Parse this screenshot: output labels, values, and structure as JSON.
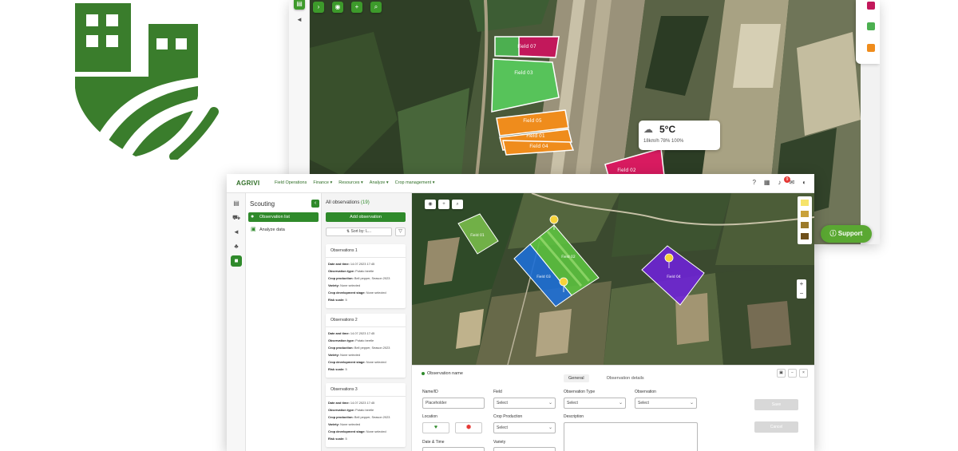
{
  "back_screenshot": {
    "field_labels": [
      "Field 07",
      "Field 03",
      "Field 05",
      "Field 01",
      "Field 04",
      "Field 02"
    ],
    "weather": {
      "temperature": "5°C",
      "details": "18km/h  78%  100%"
    },
    "support_label": "Support"
  },
  "front_screenshot": {
    "brand": "AGRIVI",
    "nav": [
      "Field Operations",
      "Finance ▾",
      "Resources ▾",
      "Analyze ▾",
      "Crop management ▾"
    ],
    "notification_count": "9",
    "scouting": {
      "title": "Scouting",
      "items": [
        {
          "label": "Observation list"
        },
        {
          "label": "Analyze data"
        }
      ]
    },
    "observations": {
      "title": "All observations",
      "count": "(19)",
      "add_label": "Add observation",
      "sort_label": "Sort by: L...",
      "cards": [
        {
          "title": "Observations 1",
          "rows": [
            {
              "k": "Date and time:",
              "v": "14.07.2023 17:45"
            },
            {
              "k": "Observation type:",
              "v": "Potato beetle"
            },
            {
              "k": "Crop production:",
              "v": "Bell pepper, Season 2023"
            },
            {
              "k": "Variety:",
              "v": "None selected"
            },
            {
              "k": "Crop development stage:",
              "v": "None selected"
            },
            {
              "k": "Risk scale:",
              "v": "5"
            }
          ]
        },
        {
          "title": "Observations 2",
          "rows": [
            {
              "k": "Date and time:",
              "v": "14.07.2023 17:45"
            },
            {
              "k": "Observation type:",
              "v": "Potato beetle"
            },
            {
              "k": "Crop production:",
              "v": "Bell pepper, Season 2023"
            },
            {
              "k": "Variety:",
              "v": "None selected"
            },
            {
              "k": "Crop development stage:",
              "v": "None selected"
            },
            {
              "k": "Risk scale:",
              "v": "5"
            }
          ]
        },
        {
          "title": "Observations 3",
          "rows": [
            {
              "k": "Date and time:",
              "v": "14.07.2023 17:45"
            },
            {
              "k": "Observation type:",
              "v": "Potato beetle"
            },
            {
              "k": "Crop production:",
              "v": "Bell pepper, Season 2023"
            },
            {
              "k": "Variety:",
              "v": "None selected"
            },
            {
              "k": "Crop development stage:",
              "v": "None selected"
            },
            {
              "k": "Risk scale:",
              "v": "5"
            }
          ]
        }
      ]
    },
    "map": {
      "field_labels": [
        "Field 01",
        "Field 02",
        "Field 03",
        "Field 04"
      ]
    },
    "detail": {
      "observation_name": "Observation name",
      "tabs": [
        "General",
        "Observation details"
      ],
      "name_label": "Name/ID",
      "name_value": "Placeholder",
      "field_label": "Field",
      "field_value": "Select",
      "obs_type_label": "Observation Type",
      "obs_type_value": "Select",
      "observation_label": "Observation",
      "observation_value": "Select",
      "location_label": "Location",
      "crop_label": "Crop Production",
      "crop_value": "Select",
      "description_label": "Description",
      "datetime_label": "Date & Time",
      "variety_label": "Variety",
      "save_label": "Save",
      "cancel_label": "Cancel"
    }
  }
}
